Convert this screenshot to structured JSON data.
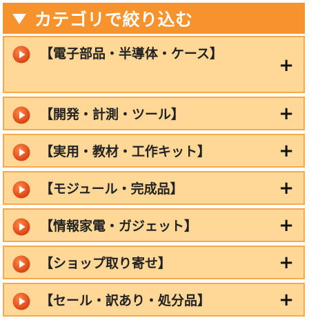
{
  "header": {
    "title": "カテゴリで絞り込む",
    "arrow_icon": "triangle-down-icon",
    "background": "#f7932d"
  },
  "categories": [
    {
      "label": "【電子部品・半導体・ケース】",
      "expand_symbol": "+"
    },
    {
      "label": "【開発・計測・ツール】",
      "expand_symbol": "+"
    },
    {
      "label": "【実用・教材・工作キット】",
      "expand_symbol": "+"
    },
    {
      "label": "【モジュール・完成品】",
      "expand_symbol": "+"
    },
    {
      "label": "【情報家電・ガジェット】",
      "expand_symbol": "+"
    },
    {
      "label": "【ショップ取り寄せ】",
      "expand_symbol": "+"
    },
    {
      "label": "【セール・訳あり・処分品】",
      "expand_symbol": "+"
    }
  ],
  "colors": {
    "item_background": "#ffd796",
    "item_border": "#f7a84a",
    "bullet": "#e8521a"
  },
  "icons": {
    "bullet": "play-circle-icon",
    "expand": "plus-icon"
  }
}
